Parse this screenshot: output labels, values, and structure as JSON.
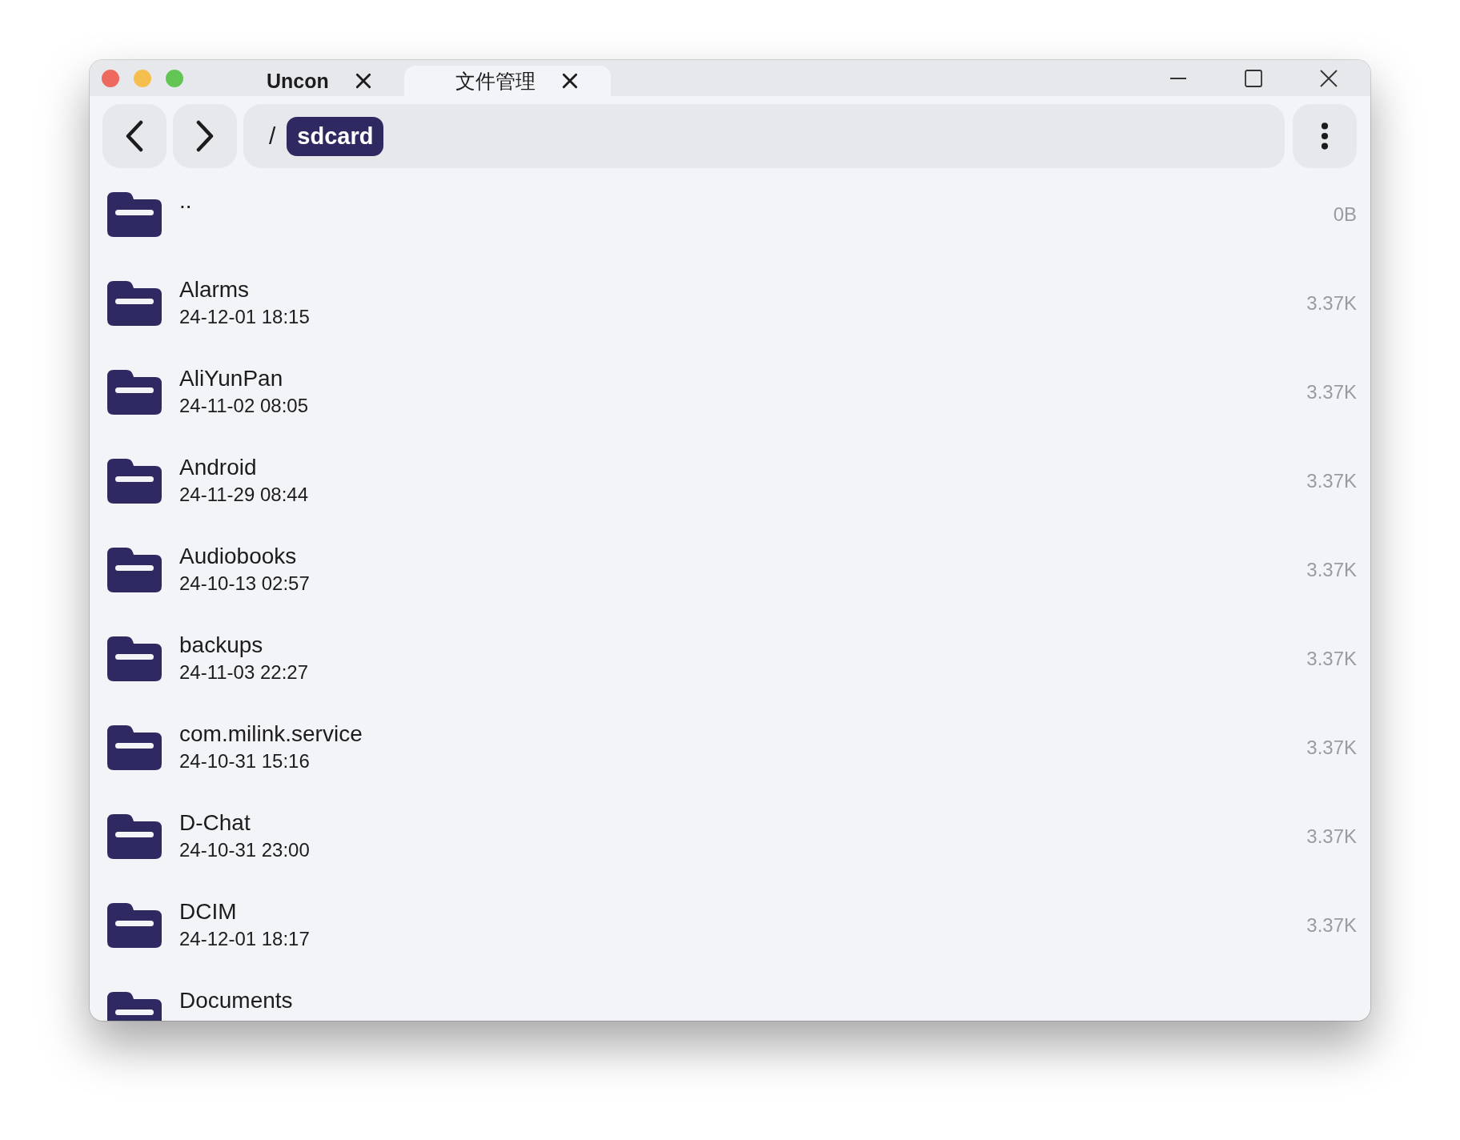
{
  "tabs": [
    {
      "label": "Uncon",
      "selected": false
    },
    {
      "label": "文件管理",
      "selected": true
    }
  ],
  "path": {
    "separator": "/",
    "segments": [
      "sdcard"
    ]
  },
  "entries": [
    {
      "name": "..",
      "size": "0B"
    },
    {
      "name": "Alarms",
      "date": "24-12-01 18:15",
      "size": "3.37K"
    },
    {
      "name": "AliYunPan",
      "date": "24-11-02 08:05",
      "size": "3.37K"
    },
    {
      "name": "Android",
      "date": "24-11-29 08:44",
      "size": "3.37K"
    },
    {
      "name": "Audiobooks",
      "date": "24-10-13 02:57",
      "size": "3.37K"
    },
    {
      "name": "backups",
      "date": "24-11-03 22:27",
      "size": "3.37K"
    },
    {
      "name": "com.milink.service",
      "date": "24-10-31 15:16",
      "size": "3.37K"
    },
    {
      "name": "D-Chat",
      "date": "24-10-31 23:00",
      "size": "3.37K"
    },
    {
      "name": "DCIM",
      "date": "24-12-01 18:17",
      "size": "3.37K"
    },
    {
      "name": "Documents"
    }
  ]
}
